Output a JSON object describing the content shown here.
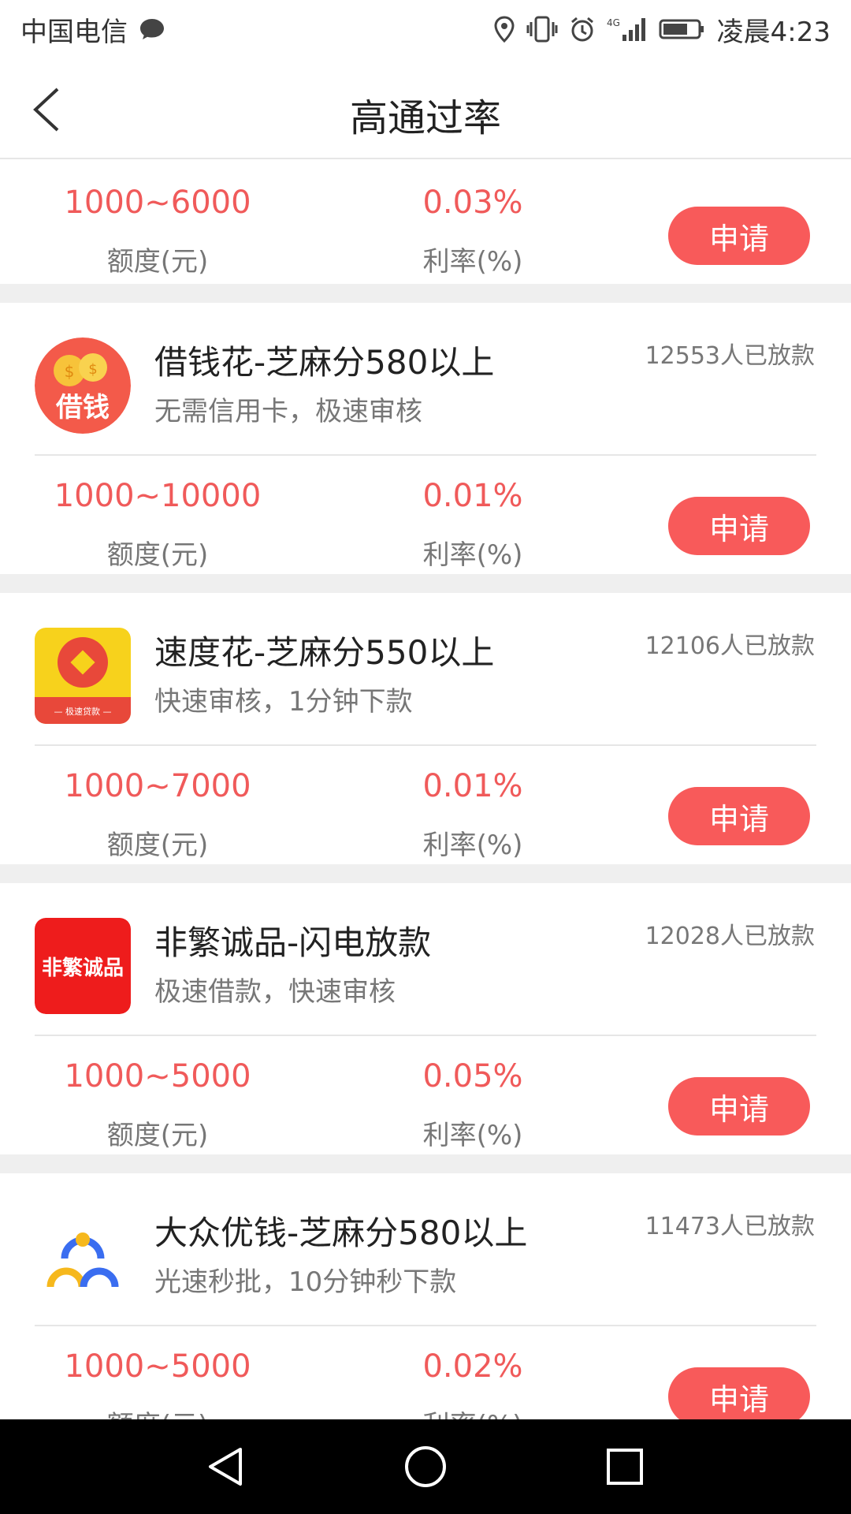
{
  "status": {
    "carrier": "中国电信",
    "time": "凌晨4:23",
    "network": "4G"
  },
  "header": {
    "title": "高通过率"
  },
  "labels": {
    "amount": "额度(元)",
    "rate": "利率(%)",
    "apply": "申请"
  },
  "top_partial": {
    "amount": "1000~6000",
    "rate": "0.03%"
  },
  "items": [
    {
      "name": "借钱花-芝麻分580以上",
      "desc": "无需信用卡，极速审核",
      "lent": "12553人已放款",
      "amount": "1000~10000",
      "rate": "0.01%",
      "logo_text": "借钱"
    },
    {
      "name": "速度花-芝麻分550以上",
      "desc": "快速审核，1分钟下款",
      "lent": "12106人已放款",
      "amount": "1000~7000",
      "rate": "0.01%",
      "logo_text": "— 极速贷款 —"
    },
    {
      "name": "非繁诚品-闪电放款",
      "desc": "极速借款，快速审核",
      "lent": "12028人已放款",
      "amount": "1000~5000",
      "rate": "0.05%",
      "logo_text": "非繁诚品"
    },
    {
      "name": "大众优钱-芝麻分580以上",
      "desc": "光速秒批，10分钟秒下款",
      "lent": "11473人已放款",
      "amount": "1000~5000",
      "rate": "0.02%",
      "logo_text": ""
    }
  ],
  "colors": {
    "accent": "#f85a5a",
    "value_red": "#f05a5a",
    "divider": "#e6e6e6",
    "gap": "#efefef"
  }
}
